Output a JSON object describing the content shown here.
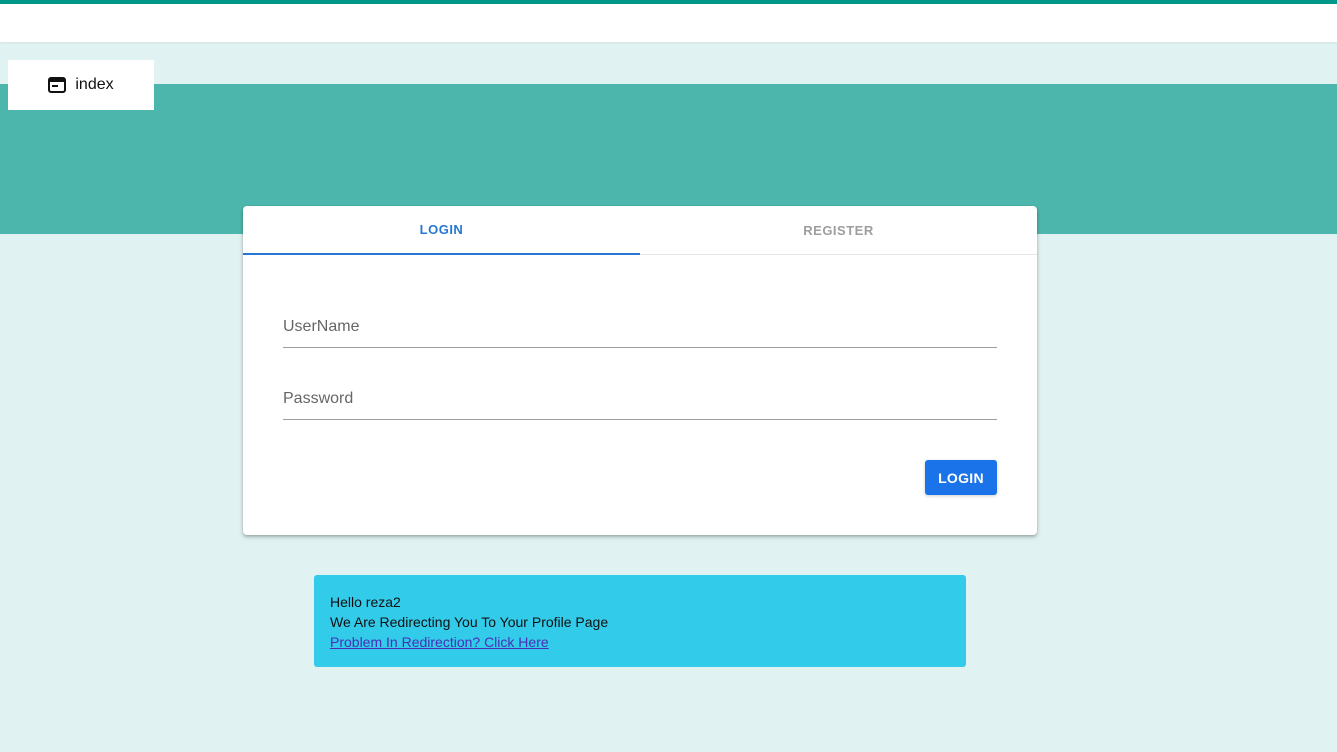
{
  "index_tab": {
    "label": "index",
    "icon": "browser-window-icon"
  },
  "tabs": [
    {
      "label": "LOGIN",
      "active": true
    },
    {
      "label": "REGISTER",
      "active": false
    }
  ],
  "form": {
    "username": {
      "placeholder": "UserName",
      "value": ""
    },
    "password": {
      "placeholder": "Password",
      "value": ""
    },
    "submit_label": "LOGIN"
  },
  "alert": {
    "greeting": "Hello reza2",
    "message": "We Are Redirecting You To Your Profile Page",
    "link_text": "Problem In Redirection? Click Here"
  },
  "colors": {
    "accent_top": "#009688",
    "teal_band": "#4db6ac",
    "background": "#e0f2f1",
    "primary": "#1a73e8",
    "alert": "#33cbea"
  }
}
